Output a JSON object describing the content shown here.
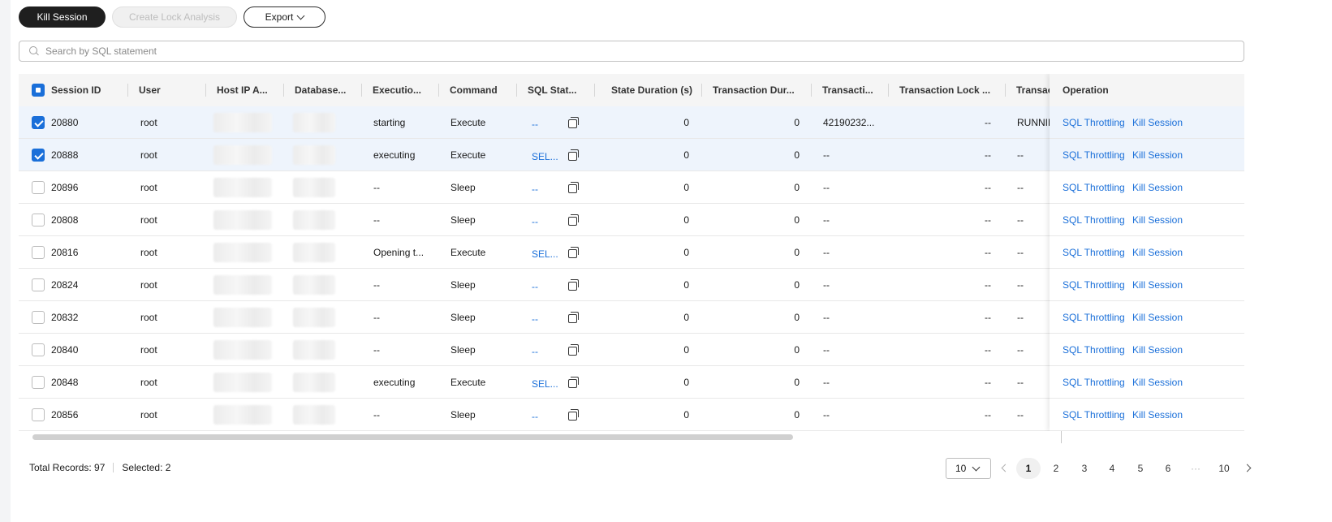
{
  "toolbar": {
    "kill_session": "Kill Session",
    "create_lock_analysis": "Create Lock Analysis",
    "export": "Export"
  },
  "search": {
    "placeholder": "Search by SQL statement"
  },
  "columns": [
    "Session ID",
    "User",
    "Host IP A...",
    "Database...",
    "Executio...",
    "Command",
    "SQL Stat...",
    "State Duration (s)",
    "Transaction Dur...",
    "Transacti...",
    "Transaction Lock ...",
    "Transac",
    "Operation"
  ],
  "rows": [
    {
      "checked": true,
      "id": "20880",
      "user": "root",
      "exec": "starting",
      "command": "Execute",
      "sql": "--",
      "state_dur": "0",
      "tx_dur": "0",
      "tx": "42190232...",
      "tx_lock": "--",
      "tx_state": "RUNNIN"
    },
    {
      "checked": true,
      "id": "20888",
      "user": "root",
      "exec": "executing",
      "command": "Execute",
      "sql": "SEL...",
      "state_dur": "0",
      "tx_dur": "0",
      "tx": "--",
      "tx_lock": "--",
      "tx_state": "--"
    },
    {
      "checked": false,
      "id": "20896",
      "user": "root",
      "exec": "--",
      "command": "Sleep",
      "sql": "--",
      "state_dur": "0",
      "tx_dur": "0",
      "tx": "--",
      "tx_lock": "--",
      "tx_state": "--"
    },
    {
      "checked": false,
      "id": "20808",
      "user": "root",
      "exec": "--",
      "command": "Sleep",
      "sql": "--",
      "state_dur": "0",
      "tx_dur": "0",
      "tx": "--",
      "tx_lock": "--",
      "tx_state": "--"
    },
    {
      "checked": false,
      "id": "20816",
      "user": "root",
      "exec": "Opening t...",
      "command": "Execute",
      "sql": "SEL...",
      "state_dur": "0",
      "tx_dur": "0",
      "tx": "--",
      "tx_lock": "--",
      "tx_state": "--"
    },
    {
      "checked": false,
      "id": "20824",
      "user": "root",
      "exec": "--",
      "command": "Sleep",
      "sql": "--",
      "state_dur": "0",
      "tx_dur": "0",
      "tx": "--",
      "tx_lock": "--",
      "tx_state": "--"
    },
    {
      "checked": false,
      "id": "20832",
      "user": "root",
      "exec": "--",
      "command": "Sleep",
      "sql": "--",
      "state_dur": "0",
      "tx_dur": "0",
      "tx": "--",
      "tx_lock": "--",
      "tx_state": "--"
    },
    {
      "checked": false,
      "id": "20840",
      "user": "root",
      "exec": "--",
      "command": "Sleep",
      "sql": "--",
      "state_dur": "0",
      "tx_dur": "0",
      "tx": "--",
      "tx_lock": "--",
      "tx_state": "--"
    },
    {
      "checked": false,
      "id": "20848",
      "user": "root",
      "exec": "executing",
      "command": "Execute",
      "sql": "SEL...",
      "state_dur": "0",
      "tx_dur": "0",
      "tx": "--",
      "tx_lock": "--",
      "tx_state": "--"
    },
    {
      "checked": false,
      "id": "20856",
      "user": "root",
      "exec": "--",
      "command": "Sleep",
      "sql": "--",
      "state_dur": "0",
      "tx_dur": "0",
      "tx": "--",
      "tx_lock": "--",
      "tx_state": "--"
    }
  ],
  "operations": {
    "sql_throttling": "SQL Throttling",
    "kill_session": "Kill Session"
  },
  "footer": {
    "total_records": "Total Records: 97",
    "selected": "Selected: 2",
    "page_size": "10",
    "pages": [
      "1",
      "2",
      "3",
      "4",
      "5",
      "6",
      "···",
      "10"
    ],
    "current_page": "1"
  },
  "colors": {
    "accent": "#1a6fd9",
    "primary_button": "#1f1f1f",
    "selected_row": "#eef4fc"
  }
}
